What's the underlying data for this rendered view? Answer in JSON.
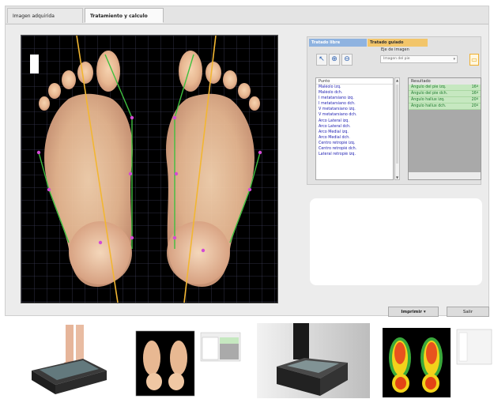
{
  "tabs": [
    {
      "label": "Imagen adquirida"
    },
    {
      "label": "Tratamiento y calculo"
    }
  ],
  "panel": {
    "tabs": [
      {
        "label": "Tratado libre"
      },
      {
        "label": "Tratado guiado"
      }
    ],
    "eje_label": "Eje de imagen",
    "eje_select_value": "Imagen del pie",
    "puntos": {
      "header": "Punto",
      "items": [
        "Maléolo izq.",
        "Maléolo dch.",
        "I metatarsiano izq.",
        "I metatarsiano dch.",
        "V metatarsiano izq.",
        "V metatarsiano dch.",
        "Arco Lateral izq.",
        "Arco Lateral dch.",
        "Arco Medial izq.",
        "Arco Medial dch.",
        "Centro retropié izq.",
        "Centro retropié dch.",
        "Lateral retropié izq."
      ]
    },
    "resultados": {
      "header": "Resultado",
      "rows": [
        {
          "label": "Ángulo del pie izq.",
          "value": "16º"
        },
        {
          "label": "Ángulo del pie dch.",
          "value": "16º"
        },
        {
          "label": "Ángulo hallux izq.",
          "value": "20º"
        },
        {
          "label": "Ángulo hallux dch.",
          "value": "20º"
        }
      ]
    }
  },
  "buttons": {
    "imprimir": "Imprimir",
    "salir": "Salir"
  },
  "colors": {
    "axis_line": "#f2b632",
    "contour_line": "#3fbf3f",
    "marker_point": "#d44ad4",
    "grid": "#3a3a55",
    "results_bg": "#c6e8c0",
    "tab_libre": "#8fb3e0",
    "tab_guiado": "#f2c56a"
  },
  "icons": {
    "pointer": "cursor-arrow-icon",
    "zoom_in": "zoom-in-icon",
    "zoom_out": "zoom-out-icon",
    "lock": "lock-icon"
  }
}
